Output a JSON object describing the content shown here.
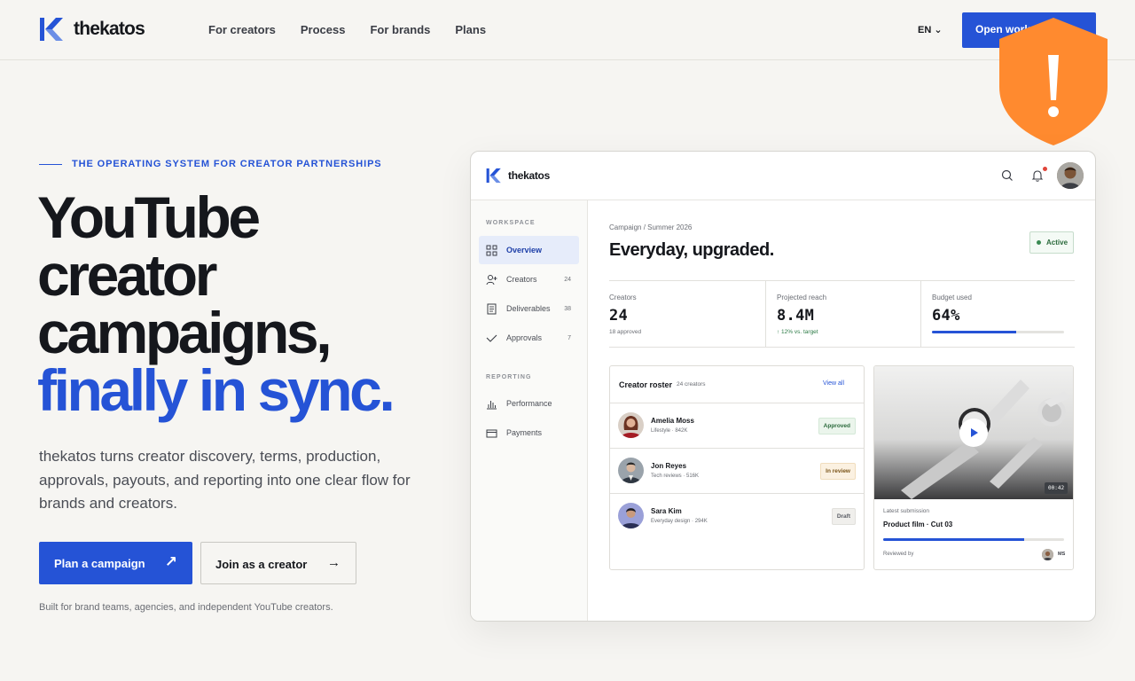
{
  "nav": {
    "brand": "thekatos",
    "links": [
      "For creators",
      "Process",
      "For brands",
      "Plans"
    ],
    "lang": "EN ⌄",
    "cta": "Open workspace"
  },
  "hero": {
    "eyebrow": "THE OPERATING SYSTEM FOR CREATOR PARTNERSHIPS",
    "headline_lines": [
      "YouTube",
      "creator",
      "campaigns,"
    ],
    "headline_accent": "finally in sync.",
    "subtitle": "thekatos turns creator discovery, terms, production, approvals, payouts, and reporting into one clear flow for brands and creators.",
    "primary_btn": "Plan a campaign",
    "primary_arrow": "↗",
    "secondary_btn": "Join as a creator",
    "secondary_arrow": "→",
    "footnote": "Built for brand teams, agencies, and independent YouTube creators."
  },
  "app": {
    "brand": "thekatos",
    "sidebar": {
      "workspace_label": "WORKSPACE",
      "reporting_label": "REPORTING",
      "items": [
        {
          "label": "Overview",
          "count": "",
          "icon": "grid-icon",
          "active": true
        },
        {
          "label": "Creators",
          "count": "24",
          "icon": "user-plus-icon",
          "active": false
        },
        {
          "label": "Deliverables",
          "count": "38",
          "icon": "document-icon",
          "active": false
        },
        {
          "label": "Approvals",
          "count": "7",
          "icon": "check-icon",
          "active": false
        }
      ],
      "reporting_items": [
        {
          "label": "Performance",
          "icon": "bar-chart-icon"
        },
        {
          "label": "Payments",
          "icon": "wallet-icon"
        }
      ]
    },
    "main": {
      "breadcrumb": "Campaign / Summer 2026",
      "title": "Everyday, upgraded.",
      "status": "Active",
      "stats": [
        {
          "label": "Creators",
          "value": "24",
          "note": "18 approved"
        },
        {
          "label": "Projected reach",
          "value": "8.4M",
          "note": "↑ 12% vs. target"
        },
        {
          "label": "Budget used",
          "value": "64%",
          "progress": 0.64
        }
      ],
      "roster": {
        "title": "Creator roster",
        "count": "24 creators",
        "view_all": "View all",
        "rows": [
          {
            "name": "Amelia Moss",
            "meta": "Lifestyle · 842K",
            "status": "Approved",
            "kind": "approved"
          },
          {
            "name": "Jon Reyes",
            "meta": "Tech reviews · 516K",
            "status": "In review",
            "kind": "review"
          },
          {
            "name": "Sara Kim",
            "meta": "Everyday design · 294K",
            "status": "Draft",
            "kind": "draft"
          }
        ]
      },
      "submission": {
        "duration": "00:42",
        "label": "Latest submission",
        "title": "Product film · Cut 03",
        "progress": 0.78,
        "reviewed_by": "Reviewed by",
        "reviewer": "MS"
      }
    }
  },
  "colors": {
    "accent": "#2553d6",
    "background": "#f6f5f2",
    "warning": "#ff8a2f"
  }
}
